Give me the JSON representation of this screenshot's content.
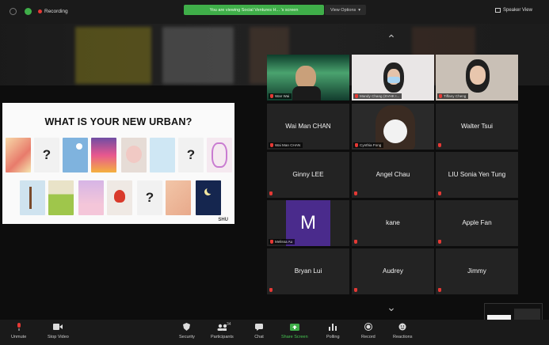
{
  "topbar": {
    "recording_label": "Recording",
    "share_banner": "You are viewing Social Ventures H... 's screen",
    "view_options": "View Options",
    "speaker_view": "Speaker View"
  },
  "slide": {
    "title": "WHAT IS YOUR NEW URBAN?",
    "question_mark": "?",
    "logo": "SHU"
  },
  "gallery": {
    "video_tiles": [
      {
        "tag": "Wan Wai"
      },
      {
        "tag": "Mandy Chang (SVHK I..."
      },
      {
        "tag": "Tiffany Cheng"
      }
    ],
    "name_tiles": [
      {
        "name": "Wai Man CHAN",
        "tag": "Wai Man CHAN"
      },
      {
        "name": "",
        "tag": "Cynthia Fong"
      },
      {
        "name": "Walter Tsui",
        "tag": ""
      },
      {
        "name": "Ginny LEE",
        "tag": ""
      },
      {
        "name": "Angel Chau",
        "tag": ""
      },
      {
        "name": "LIU Sonia Yen Tung",
        "tag": ""
      },
      {
        "name": "",
        "tag": "Melissa Au",
        "avatar_letter": "M"
      },
      {
        "name": "kane",
        "tag": ""
      },
      {
        "name": "Apple Fan",
        "tag": ""
      },
      {
        "name": "Bryan Lui",
        "tag": ""
      },
      {
        "name": "Audrey",
        "tag": ""
      },
      {
        "name": "Jimmy",
        "tag": ""
      }
    ]
  },
  "toolbar": {
    "unmute": "Unmute",
    "stop_video": "Stop Video",
    "security": "Security",
    "participants": "Participants",
    "participants_count": "34",
    "chat": "Chat",
    "share_screen": "Share Screen",
    "polling": "Polling",
    "record": "Record",
    "reactions": "Reactions"
  },
  "colors": {
    "share_green": "#3fae49",
    "mute_red": "#e53935",
    "avatar_purple": "#4a2b8c"
  }
}
